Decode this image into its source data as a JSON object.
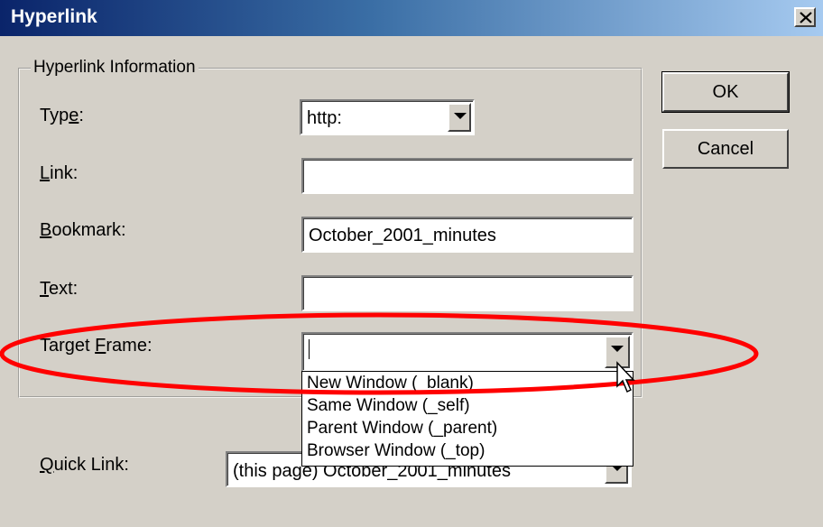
{
  "window": {
    "title": "Hyperlink"
  },
  "group": {
    "legend": "Hyperlink Information"
  },
  "fields": {
    "type": {
      "label_pre": "Typ",
      "label_u": "e",
      "label_post": ":",
      "value": "http:"
    },
    "link": {
      "label_pre": "",
      "label_u": "L",
      "label_post": "ink:",
      "value": ""
    },
    "bookmark": {
      "label_pre": "",
      "label_u": "B",
      "label_post": "ookmark:",
      "value": "October_2001_minutes"
    },
    "text": {
      "label_pre": "",
      "label_u": "T",
      "label_post": "ext:",
      "value": ""
    },
    "target_frame": {
      "label_pre": "Target ",
      "label_u": "F",
      "label_post": "rame:",
      "value": ""
    },
    "quick_link": {
      "label_pre": "",
      "label_u": "Q",
      "label_post": "uick Link:",
      "value": "(this page) October_2001_minutes"
    }
  },
  "target_frame_options": [
    "New Window (_blank)",
    "Same Window (_self)",
    "Parent Window (_parent)",
    "Browser Window (_top)"
  ],
  "buttons": {
    "ok": "OK",
    "cancel": "Cancel"
  },
  "colors": {
    "title_bar_start": "#0a246a",
    "title_bar_end": "#a6caf0",
    "highlight_ellipse": "#ff0000",
    "dialog_bg": "#d4d0c8"
  },
  "icons": {
    "close": "close-icon",
    "dropdown": "chevron-down-icon",
    "pointer": "mouse-pointer-icon"
  }
}
